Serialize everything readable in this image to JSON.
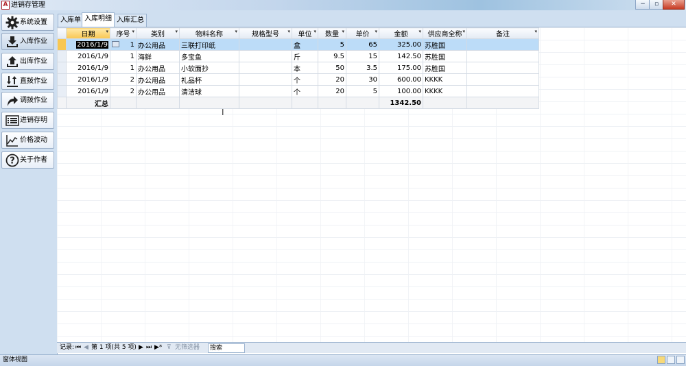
{
  "window": {
    "title": "进销存管理",
    "app_icon": "A",
    "buttons": {
      "minimize": "−",
      "restore": "▫",
      "close": "✕"
    }
  },
  "sidebar": {
    "items": [
      {
        "label": "系统设置",
        "icon": "gear-icon"
      },
      {
        "label": "入库作业",
        "icon": "download-icon"
      },
      {
        "label": "出库作业",
        "icon": "upload-icon"
      },
      {
        "label": "直拨作业",
        "icon": "transfer-arrows-icon"
      },
      {
        "label": "调拨作业",
        "icon": "redirect-arrow-icon"
      },
      {
        "label": "进销存明细",
        "icon": "list-icon"
      },
      {
        "label": "价格波动",
        "icon": "line-chart-icon"
      },
      {
        "label": "关于作者",
        "icon": "question-icon"
      }
    ]
  },
  "tabs": [
    {
      "label": "入库单"
    },
    {
      "label": "入库明细"
    },
    {
      "label": "入库汇总"
    }
  ],
  "table": {
    "columns": [
      "日期",
      "序号",
      "类别",
      "物料名称",
      "规格型号",
      "单位",
      "数量",
      "单价",
      "金额",
      "供应商全称",
      "备注"
    ],
    "rows": [
      [
        "2016/1/9",
        "1",
        "办公用品",
        "三联打印纸",
        "",
        "盒",
        "5",
        "65",
        "325.00",
        "苏胜国",
        ""
      ],
      [
        "2016/1/9",
        "1",
        "海鲜",
        "多宝鱼",
        "",
        "斤",
        "9.5",
        "15",
        "142.50",
        "苏胜国",
        ""
      ],
      [
        "2016/1/9",
        "1",
        "办公用品",
        "小软面抄",
        "",
        "本",
        "50",
        "3.5",
        "175.00",
        "苏胜国",
        ""
      ],
      [
        "2016/1/9",
        "2",
        "办公用品",
        "礼品杯",
        "",
        "个",
        "20",
        "30",
        "600.00",
        "KKKK",
        ""
      ],
      [
        "2016/1/9",
        "2",
        "办公用品",
        "清洁球",
        "",
        "个",
        "20",
        "5",
        "100.00",
        "KKKK",
        ""
      ]
    ],
    "total_label": "汇总",
    "total_amount": "1342.50"
  },
  "record_nav": {
    "label": "记录:",
    "first": "⏮",
    "prev": "◀",
    "position": "第 1 项(共 5 项)",
    "next": "▶",
    "last": "⏭",
    "new": "▶*",
    "filter": "无筛选器",
    "search": "搜索"
  },
  "status": {
    "view": "窗体视图"
  }
}
